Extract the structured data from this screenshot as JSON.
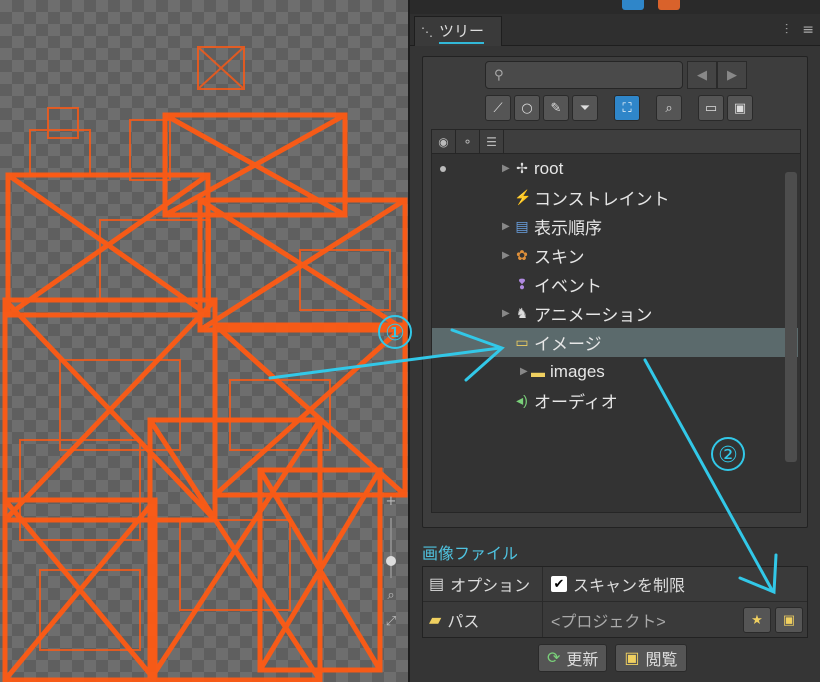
{
  "panel": {
    "tab_label": "ツリー",
    "search_placeholder": ""
  },
  "tree": {
    "items": [
      {
        "label": "root",
        "icon": "crosshair-icon",
        "has_children": true
      },
      {
        "label": "コンストレイント",
        "icon": "constraint-icon",
        "has_children": false
      },
      {
        "label": "表示順序",
        "icon": "draw-order-icon",
        "has_children": true
      },
      {
        "label": "スキン",
        "icon": "skin-icon",
        "has_children": true
      },
      {
        "label": "イベント",
        "icon": "event-icon",
        "has_children": false
      },
      {
        "label": "アニメーション",
        "icon": "animation-icon",
        "has_children": true
      },
      {
        "label": "イメージ",
        "icon": "folder-icon",
        "has_children": false,
        "selected": true
      },
      {
        "label": "images",
        "icon": "folder-icon",
        "has_children": true
      },
      {
        "label": "オーディオ",
        "icon": "audio-icon",
        "has_children": false
      }
    ]
  },
  "properties": {
    "section_title": "画像ファイル",
    "options_key": "オプション",
    "options_value": "スキャンを制限",
    "options_checked": true,
    "path_key": "パス",
    "path_value": "<プロジェクト>"
  },
  "actions": {
    "refresh_label": "更新",
    "browse_label": "閲覧"
  },
  "annotations": {
    "marker_1": "①",
    "marker_2": "②"
  },
  "colors": {
    "accent": "#32b8d8",
    "selection": "#5b6a6c",
    "missing_overlay": "#ff5a14"
  }
}
